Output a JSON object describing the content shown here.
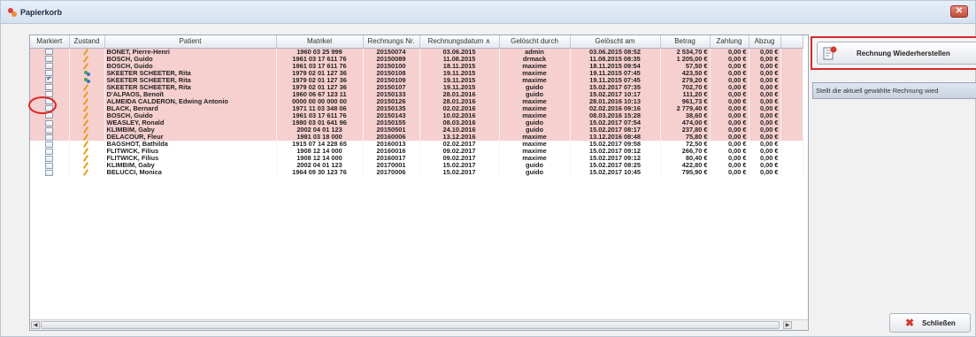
{
  "window": {
    "title": "Papierkorb",
    "close_glyph": "✕"
  },
  "table": {
    "headers": [
      "Markiert",
      "Zustand",
      "Patient",
      "Matrikel",
      "Rechnungs Nr.",
      "Rechnungsdatum ∧",
      "Gelöscht durch",
      "Gelöscht am",
      "Betrag",
      "Zahlung",
      "Abzug"
    ],
    "rows": [
      {
        "checked": false,
        "status": "pencil",
        "style": "pink",
        "patient": "BONET, Pierre-Henri",
        "matrikel": "1960 03 25 999",
        "nr": "20150074",
        "datum": "03.06.2015",
        "geloescht_durch": "admin",
        "geloescht_am": "03.06.2015 08:52",
        "betrag": "2 534,70 €",
        "zahlung": "0,00 €",
        "abzug": "0,00 €"
      },
      {
        "checked": false,
        "status": "pencil",
        "style": "pink",
        "patient": "BOSCH, Guido",
        "matrikel": "1961 03 17 611 76",
        "nr": "20150089",
        "datum": "11.08.2015",
        "geloescht_durch": "drmack",
        "geloescht_am": "11.08.2015 08:35",
        "betrag": "1 205,00 €",
        "zahlung": "0,00 €",
        "abzug": "0,00 €"
      },
      {
        "checked": false,
        "status": "pencil",
        "style": "pink",
        "patient": "BOSCH, Guido",
        "matrikel": "1961 03 17 611 76",
        "nr": "20150100",
        "datum": "18.11.2015",
        "geloescht_durch": "maxime",
        "geloescht_am": "18.11.2015 09:54",
        "betrag": "57,50 €",
        "zahlung": "0,00 €",
        "abzug": "0,00 €"
      },
      {
        "checked": false,
        "status": "users",
        "style": "pink",
        "patient": "SKEETER SCHEETER, Rita",
        "matrikel": "1979 02 01 127 36",
        "nr": "20150108",
        "datum": "19.11.2015",
        "geloescht_durch": "maxime",
        "geloescht_am": "19.11.2015 07:45",
        "betrag": "423,50 €",
        "zahlung": "0,00 €",
        "abzug": "0,00 €"
      },
      {
        "checked": true,
        "status": "users",
        "style": "pink",
        "patient": "SKEETER SCHEETER, Rita",
        "matrikel": "1979 02 01 127 36",
        "nr": "20150109",
        "datum": "19.11.2015",
        "geloescht_durch": "maxime",
        "geloescht_am": "19.11.2015 07:45",
        "betrag": "279,20 €",
        "zahlung": "0,00 €",
        "abzug": "0,00 €"
      },
      {
        "checked": false,
        "status": "pencil",
        "style": "pink",
        "patient": "SKEETER SCHEETER, Rita",
        "matrikel": "1979 02 01 127 36",
        "nr": "20150107",
        "datum": "19.11.2015",
        "geloescht_durch": "guido",
        "geloescht_am": "15.02.2017 07:35",
        "betrag": "702,70 €",
        "zahlung": "0,00 €",
        "abzug": "0,00 €"
      },
      {
        "checked": false,
        "status": "pencil",
        "style": "pink",
        "patient": "D'ALPAOS, Benoît",
        "matrikel": "1960 06 67 123 11",
        "nr": "20150133",
        "datum": "28.01.2016",
        "geloescht_durch": "guido",
        "geloescht_am": "15.02.2017 10:17",
        "betrag": "111,20 €",
        "zahlung": "0,00 €",
        "abzug": "0,00 €"
      },
      {
        "checked": false,
        "status": "pencil",
        "style": "pink",
        "patient": "ALMEIDA CALDERON, Edwing Antonio",
        "matrikel": "0000 00 00 000 00",
        "nr": "20150126",
        "datum": "28.01.2016",
        "geloescht_durch": "maxime",
        "geloescht_am": "28.01.2016 10:13",
        "betrag": "961,73 €",
        "zahlung": "0,00 €",
        "abzug": "0,00 €"
      },
      {
        "checked": false,
        "status": "pencil",
        "style": "pink",
        "patient": "BLACK, Bernard",
        "matrikel": "1971 11 03 348 06",
        "nr": "20150135",
        "datum": "02.02.2016",
        "geloescht_durch": "maxime",
        "geloescht_am": "02.02.2016 09:16",
        "betrag": "2 779,40 €",
        "zahlung": "0,00 €",
        "abzug": "0,00 €"
      },
      {
        "checked": false,
        "status": "pencil",
        "style": "pink",
        "patient": "BOSCH, Guido",
        "matrikel": "1961 03 17 611 76",
        "nr": "20150143",
        "datum": "10.02.2016",
        "geloescht_durch": "maxime",
        "geloescht_am": "08.03.2016 15:28",
        "betrag": "38,60 €",
        "zahlung": "0,00 €",
        "abzug": "0,00 €"
      },
      {
        "checked": false,
        "status": "pencil",
        "style": "pink",
        "patient": "WEASLEY, Ronald",
        "matrikel": "1980 03 01 641 96",
        "nr": "20150155",
        "datum": "08.03.2016",
        "geloescht_durch": "guido",
        "geloescht_am": "15.02.2017 07:54",
        "betrag": "474,00 €",
        "zahlung": "0,00 €",
        "abzug": "0,00 €"
      },
      {
        "checked": false,
        "status": "pencil",
        "style": "pink",
        "patient": "KLIMBIM, Gaby",
        "matrikel": "2002 04 01 123",
        "nr": "20150501",
        "datum": "24.10.2016",
        "geloescht_durch": "guido",
        "geloescht_am": "15.02.2017 08:17",
        "betrag": "237,80 €",
        "zahlung": "0,00 €",
        "abzug": "0,00 €"
      },
      {
        "checked": false,
        "status": "pencil",
        "style": "pink",
        "patient": "DELACOUR, Fleur",
        "matrikel": "1981 03 18 000",
        "nr": "20160006",
        "datum": "13.12.2016",
        "geloescht_durch": "maxime",
        "geloescht_am": "13.12.2016 08:48",
        "betrag": "75,80 €",
        "zahlung": "0,00 €",
        "abzug": "0,00 €"
      },
      {
        "checked": false,
        "status": "pencil",
        "style": "white",
        "patient": "BAGSHOT, Bathilda",
        "matrikel": "1915 07 14 228 65",
        "nr": "20160013",
        "datum": "02.02.2017",
        "geloescht_durch": "maxime",
        "geloescht_am": "15.02.2017 09:58",
        "betrag": "72,50 €",
        "zahlung": "0,00 €",
        "abzug": "0,00 €"
      },
      {
        "checked": false,
        "status": "pencil",
        "style": "white",
        "patient": "FLITWICK, Filius",
        "matrikel": "1908 12 14 000",
        "nr": "20160016",
        "datum": "09.02.2017",
        "geloescht_durch": "maxime",
        "geloescht_am": "15.02.2017 09:12",
        "betrag": "266,70 €",
        "zahlung": "0,00 €",
        "abzug": "0,00 €"
      },
      {
        "checked": false,
        "status": "pencil",
        "style": "white",
        "patient": "FLITWICK, Filius",
        "matrikel": "1908 12 14 000",
        "nr": "20160017",
        "datum": "09.02.2017",
        "geloescht_durch": "maxime",
        "geloescht_am": "15.02.2017 09:12",
        "betrag": "80,40 €",
        "zahlung": "0,00 €",
        "abzug": "0,00 €"
      },
      {
        "checked": false,
        "status": "pencil",
        "style": "white",
        "patient": "KLIMBIM, Gaby",
        "matrikel": "2002 04 01 123",
        "nr": "20170001",
        "datum": "15.02.2017",
        "geloescht_durch": "guido",
        "geloescht_am": "15.02.2017 08:25",
        "betrag": "422,80 €",
        "zahlung": "0,00 €",
        "abzug": "0,00 €"
      },
      {
        "checked": false,
        "status": "pencil",
        "style": "white",
        "patient": "BELUCCI, Monica",
        "matrikel": "1964 09 30 123 76",
        "nr": "20170006",
        "datum": "15.02.2017",
        "geloescht_durch": "guido",
        "geloescht_am": "15.02.2017 10:45",
        "betrag": "795,90 €",
        "zahlung": "0,00 €",
        "abzug": "0,00 €"
      }
    ]
  },
  "scrollbar": {
    "left_glyph": "◀",
    "right_glyph": "▶"
  },
  "actions": {
    "restore_label": "Rechnung Wiederherstellen",
    "restore_tooltip": "Stellt die aktuell gewählte Rechnung wied",
    "close_label": "Schließen",
    "close_glyph": "✖"
  },
  "colors": {
    "deleted_row": "#f6cfcf",
    "highlight": "#d92a2a"
  }
}
